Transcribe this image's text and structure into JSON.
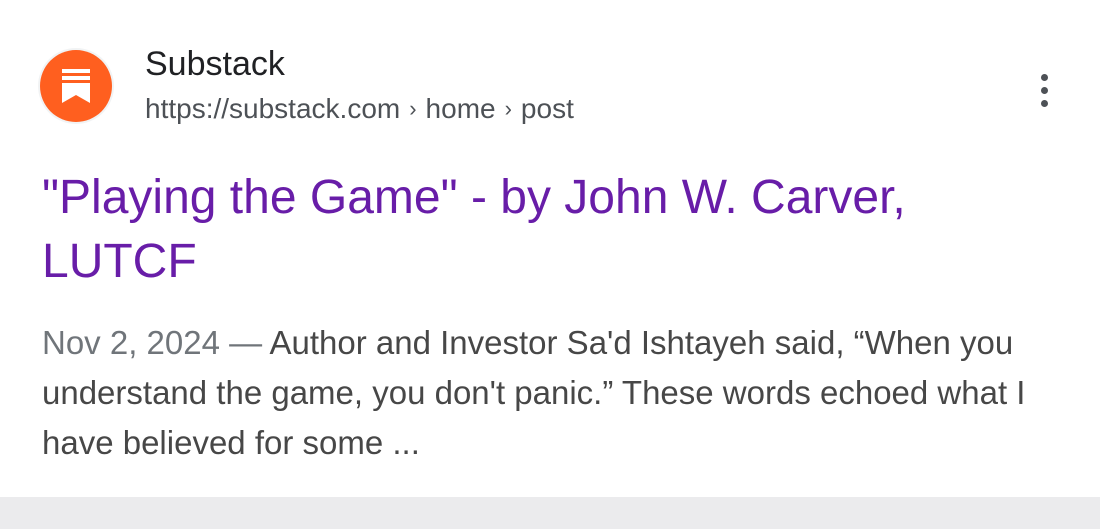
{
  "result": {
    "site_name": "Substack",
    "url": {
      "domain": "https://substack.com",
      "separator": "›",
      "crumb_1": "home",
      "crumb_2": "post"
    },
    "favicon_icon": "substack-logo-icon",
    "menu_icon": "more-vert-icon",
    "title": "\"Playing the Game\" - by John W. Carver, LUTCF",
    "date": "Nov 2, 2024",
    "date_separator": " — ",
    "snippet": "Author and Investor Sa'd Ishtayeh said, “When you understand the game, you don't panic.” These words echoed what I have believed for some ..."
  },
  "colors": {
    "favicon_bg": "#ff5f1f",
    "title_visited": "#681da8",
    "text_primary": "#202124",
    "text_secondary": "#4d5156",
    "snippet_text": "#474747",
    "bottom_bar": "#ebebed"
  }
}
